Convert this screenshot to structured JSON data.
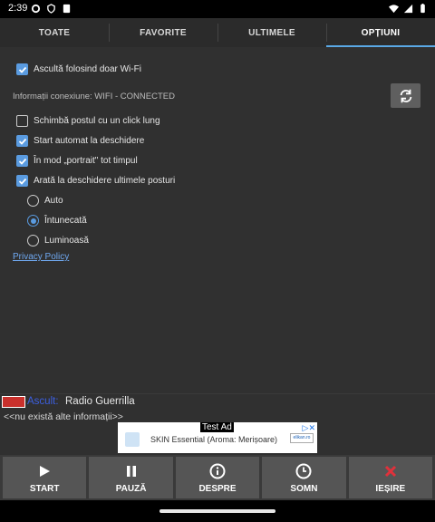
{
  "status": {
    "time": "2:39"
  },
  "tabs": [
    {
      "label": "TOATE"
    },
    {
      "label": "FAVORITE"
    },
    {
      "label": "ULTIMELE"
    },
    {
      "label": "OPȚIUNI"
    }
  ],
  "options": {
    "wifi_only": {
      "label": "Ascultă folosind doar Wi-Fi",
      "checked": true
    },
    "connection_info": "Informații conexiune: WIFI - CONNECTED",
    "long_click": {
      "label": "Schimbă postul cu un click lung",
      "checked": false
    },
    "auto_start": {
      "label": "Start automat la deschidere",
      "checked": true
    },
    "portrait": {
      "label": "În mod „portrait\" tot timpul",
      "checked": true
    },
    "show_recent": {
      "label": "Arată la deschidere ultimele posturi",
      "checked": true
    },
    "theme": [
      {
        "label": "Auto",
        "selected": false
      },
      {
        "label": "Întunecată",
        "selected": true
      },
      {
        "label": "Luminoasă",
        "selected": false
      }
    ],
    "privacy_link": "Privacy Policy"
  },
  "now_playing": {
    "label": "Ascult:",
    "station": "Radio Guerrilla",
    "info": "<<nu există alte informații>>"
  },
  "ad": {
    "label": "Test Ad",
    "text": "SKIN Essential (Aroma: Merișoare)",
    "brand": "elikan.ro"
  },
  "buttons": [
    {
      "label": "START",
      "icon": "play-icon"
    },
    {
      "label": "PAUZĂ",
      "icon": "pause-icon"
    },
    {
      "label": "DESPRE",
      "icon": "info-icon"
    },
    {
      "label": "SOMN",
      "icon": "clock-icon"
    },
    {
      "label": "IEȘIRE",
      "icon": "close-icon"
    }
  ],
  "colors": {
    "accent": "#5a9be0",
    "exit": "#e0313b",
    "link": "#6fa8f0"
  }
}
